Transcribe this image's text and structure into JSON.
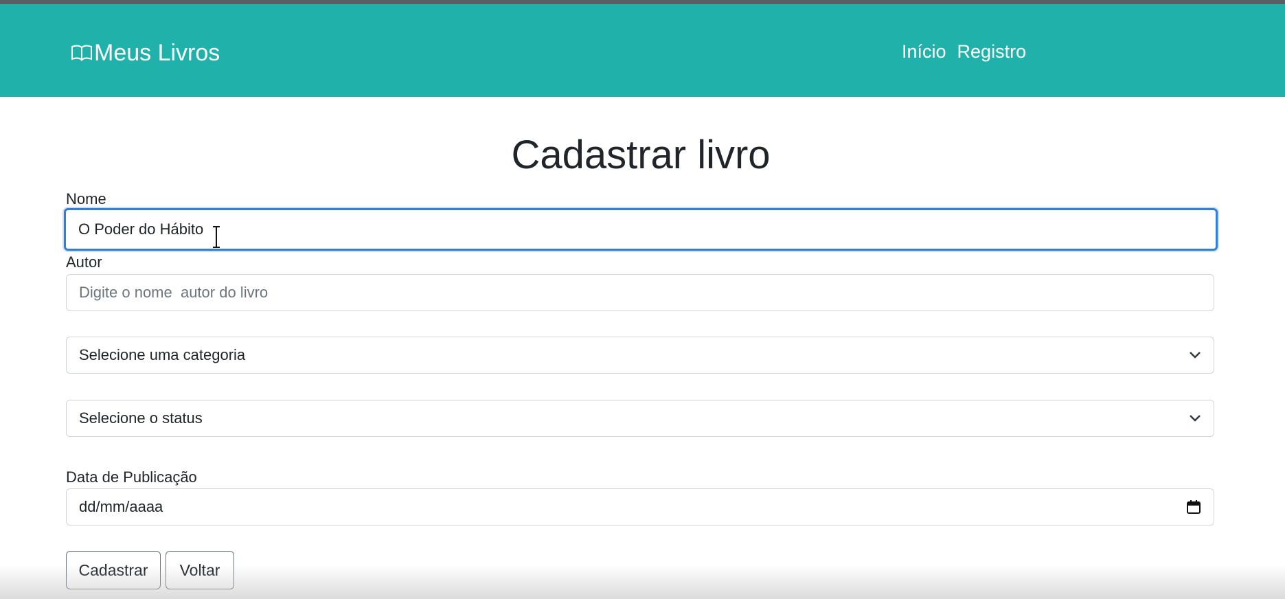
{
  "navbar": {
    "brand": "Meus Livros",
    "brand_icon": "book-icon",
    "links": [
      "Início",
      "Registro"
    ],
    "color": "#20b2aa"
  },
  "page": {
    "title": "Cadastrar livro"
  },
  "form": {
    "nome_label": "Nome",
    "nome_value": "O Poder do Hábito",
    "autor_label": "Autor",
    "autor_placeholder": "Digite o nome  autor do livro",
    "categoria_selected": "Selecione uma categoria",
    "status_selected": "Selecione o status",
    "data_label": "Data de Publicação",
    "data_placeholder": "dd/mm/aaaa",
    "submit_label": "Cadastrar",
    "back_label": "Voltar"
  },
  "icons": {
    "select_chevron": "chevron-down-icon",
    "date_picker": "calendar-icon",
    "text_cursor": "i-beam-cursor-icon"
  }
}
